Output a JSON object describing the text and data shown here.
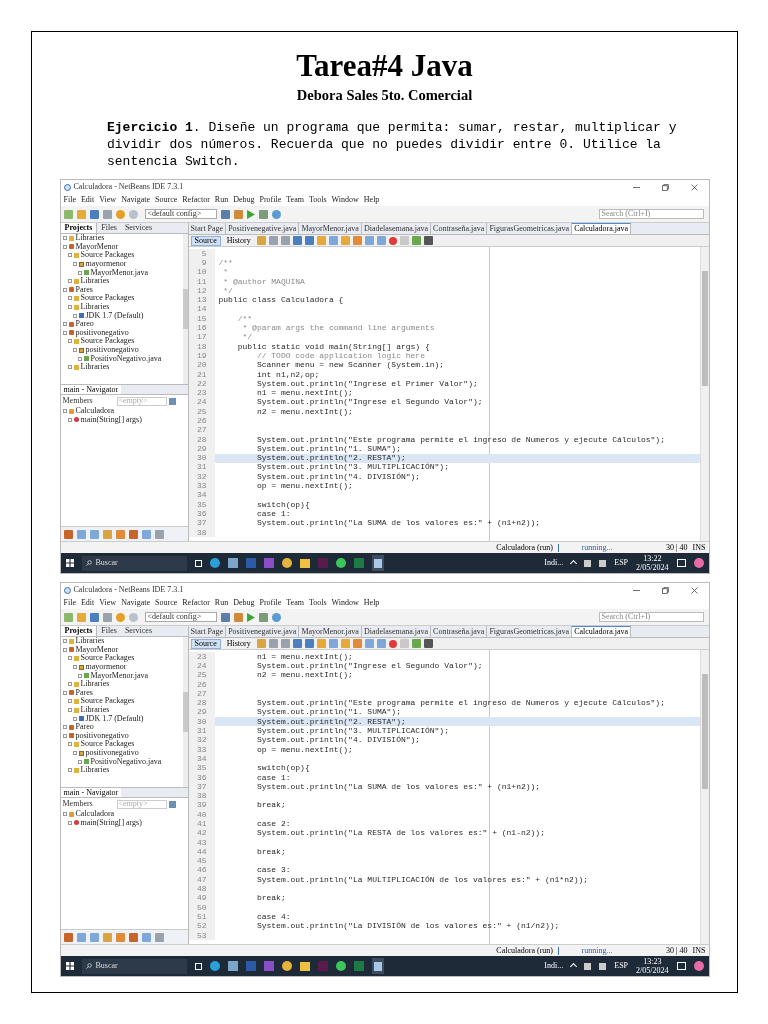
{
  "document": {
    "title": "Tarea#4 Java",
    "subtitle": "Debora Sales 5to. Comercial",
    "exercise": "**Ejercicio 1**. Diseñe un programa que permita: sumar, restar, multiplicar y dividir dos números. Recuerda que no puedes dividir entre 0. Utilice la sentencia Switch."
  },
  "screenshots": [
    {
      "window_title": "Calculadora - NetBeans IDE 7.3.1",
      "menu": [
        "File",
        "Edit",
        "View",
        "Navigate",
        "Source",
        "Refactor",
        "Run",
        "Debug",
        "Profile",
        "Team",
        "Tools",
        "Window",
        "Help"
      ],
      "config": "<default config>",
      "search_placeholder": "Search (Ctrl+I)",
      "panel_tabs": [
        {
          "label": "Projects",
          "selected": true
        },
        {
          "label": "Files",
          "selected": false
        },
        {
          "label": "Services",
          "selected": false
        }
      ],
      "project_tree": [
        {
          "label": "Libraries",
          "kind": "folder"
        },
        {
          "label": "MayorMenor",
          "kind": "project",
          "children": [
            {
              "label": "Source Packages",
              "kind": "folder",
              "children": [
                {
                  "label": "mayormenor",
                  "kind": "package",
                  "children": [
                    {
                      "label": "MayorMenor.java",
                      "kind": "file"
                    }
                  ]
                }
              ]
            },
            {
              "label": "Libraries",
              "kind": "folder"
            }
          ]
        },
        {
          "label": "Pares",
          "kind": "project",
          "children": [
            {
              "label": "Source Packages",
              "kind": "folder"
            },
            {
              "label": "Libraries",
              "kind": "folder",
              "children": [
                {
                  "label": "JDK 1.7 (Default)",
                  "kind": "jdk"
                }
              ]
            }
          ]
        },
        {
          "label": "Pareo",
          "kind": "project"
        },
        {
          "label": "positivonegativo",
          "kind": "project",
          "children": [
            {
              "label": "Source Packages",
              "kind": "folder",
              "children": [
                {
                  "label": "positivonegativo",
                  "kind": "package",
                  "children": [
                    {
                      "label": "PositivoNegativo.java",
                      "kind": "file"
                    }
                  ]
                }
              ]
            },
            {
              "label": "Libraries",
              "kind": "folder"
            }
          ]
        }
      ],
      "navigator": {
        "title": "main - Navigator",
        "members_label": "Members",
        "filter_placeholder": "<empty>",
        "tree": [
          {
            "label": "Calculadora",
            "kind": "class",
            "children": [
              {
                "label": "main(String[] args)",
                "kind": "method"
              }
            ]
          }
        ]
      },
      "editor_tabs": [
        {
          "label": "Start Page",
          "selected": false
        },
        {
          "label": "Positivenegative.java",
          "selected": false
        },
        {
          "label": "MayorMenor.java",
          "selected": false
        },
        {
          "label": "Diadelasemana.java",
          "selected": false
        },
        {
          "label": "Contraseña.java",
          "selected": false
        },
        {
          "label": "FigurasGeometricas.java",
          "selected": false
        },
        {
          "label": "Calculadora.java",
          "selected": true
        }
      ],
      "editor_modes": [
        {
          "label": "Source",
          "selected": true
        },
        {
          "label": "History",
          "selected": false
        }
      ],
      "code_lines": [
        {
          "number": "5",
          "current": false
        },
        {
          "number": "9",
          "text": "/**",
          "kind": "comment",
          "current": false
        },
        {
          "number": "10",
          "text": " *",
          "kind": "comment",
          "current": false
        },
        {
          "number": "11",
          "text": " * @author MAQUINA",
          "kind": "comment",
          "current": false
        },
        {
          "number": "12",
          "text": " */",
          "kind": "comment",
          "current": false
        },
        {
          "number": "13",
          "text": "public class Calculadora {",
          "kind": "code",
          "current": false
        },
        {
          "number": "14",
          "current": false
        },
        {
          "number": "15",
          "text": "    /**",
          "kind": "comment",
          "current": false
        },
        {
          "number": "16",
          "text": "     * @param args the command line arguments",
          "kind": "comment",
          "current": false
        },
        {
          "number": "17",
          "text": "     */",
          "kind": "comment",
          "current": false
        },
        {
          "number": "18",
          "text": "    public static void main(String[] args) {",
          "kind": "code",
          "current": false
        },
        {
          "number": "19",
          "text": "        // TODO code application logic here",
          "kind": "comment",
          "current": false
        },
        {
          "number": "20",
          "text": "        Scanner menu = new Scanner (System.in);",
          "kind": "code",
          "current": false
        },
        {
          "number": "21",
          "text": "        int n1,n2,op;",
          "kind": "code",
          "current": false
        },
        {
          "number": "22",
          "text": "        System.out.println(\"Ingrese el Primer Valor\");",
          "kind": "code",
          "current": false
        },
        {
          "number": "23",
          "text": "        n1 = menu.nextInt();",
          "kind": "code",
          "current": false
        },
        {
          "number": "24",
          "text": "        System.out.println(\"Ingrese el Segundo Valor\");",
          "kind": "code",
          "current": false
        },
        {
          "number": "25",
          "text": "        n2 = menu.nextInt();",
          "kind": "code",
          "current": false
        },
        {
          "number": "26",
          "current": false
        },
        {
          "number": "27",
          "current": false
        },
        {
          "number": "28",
          "text": "        System.out.println(\"Este programa permite el ingreso de Numeros y ejecute Cálculos\");",
          "kind": "code",
          "current": false
        },
        {
          "number": "29",
          "text": "        System.out.println(\"1. SUMA\");",
          "kind": "code",
          "current": false
        },
        {
          "number": "30",
          "text": "        System.out.println(\"2. RESTA\");",
          "kind": "code",
          "current": true
        },
        {
          "number": "31",
          "text": "        System.out.println(\"3. MULTIPLICACIÓN\");",
          "kind": "code",
          "current": false
        },
        {
          "number": "32",
          "text": "        System.out.println(\"4. DIVISIÓN\");",
          "kind": "code",
          "current": false
        },
        {
          "number": "33",
          "text": "        op = menu.nextInt();",
          "kind": "code",
          "current": false
        },
        {
          "number": "34",
          "current": false
        },
        {
          "number": "35",
          "text": "        switch(op){",
          "kind": "code",
          "current": false
        },
        {
          "number": "36",
          "text": "        case 1:",
          "kind": "code",
          "current": false
        },
        {
          "number": "37",
          "text": "        System.out.println(\"La SUMA de los valores es:\" + (n1+n2));",
          "kind": "code",
          "current": false
        },
        {
          "number": "38",
          "current": false
        }
      ],
      "status": {
        "process": "Calculadora (run)",
        "progress_label": "running...",
        "position": "30 | 40",
        "mode": "INS"
      },
      "taskbar": {
        "search": "Buscar",
        "weather": "Indi...",
        "language": "ESP",
        "time": "13:22",
        "date": "2/05/2024"
      }
    },
    {
      "window_title": "Calculadora - NetBeans IDE 7.3.1",
      "menu": [
        "File",
        "Edit",
        "View",
        "Navigate",
        "Source",
        "Refactor",
        "Run",
        "Debug",
        "Profile",
        "Team",
        "Tools",
        "Window",
        "Help"
      ],
      "config": "<default config>",
      "search_placeholder": "Search (Ctrl+I)",
      "panel_tabs": [
        {
          "label": "Projects",
          "selected": true
        },
        {
          "label": "Files",
          "selected": false
        },
        {
          "label": "Services",
          "selected": false
        }
      ],
      "project_tree": [
        {
          "label": "Libraries",
          "kind": "folder"
        },
        {
          "label": "MayorMenor",
          "kind": "project",
          "children": [
            {
              "label": "Source Packages",
              "kind": "folder",
              "children": [
                {
                  "label": "mayormenor",
                  "kind": "package",
                  "children": [
                    {
                      "label": "MayorMenor.java",
                      "kind": "file"
                    }
                  ]
                }
              ]
            },
            {
              "label": "Libraries",
              "kind": "folder"
            }
          ]
        },
        {
          "label": "Pares",
          "kind": "project",
          "children": [
            {
              "label": "Source Packages",
              "kind": "folder"
            },
            {
              "label": "Libraries",
              "kind": "folder",
              "children": [
                {
                  "label": "JDK 1.7 (Default)",
                  "kind": "jdk"
                }
              ]
            }
          ]
        },
        {
          "label": "Pareo",
          "kind": "project"
        },
        {
          "label": "positivonegativo",
          "kind": "project",
          "children": [
            {
              "label": "Source Packages",
              "kind": "folder",
              "children": [
                {
                  "label": "positivonegativo",
                  "kind": "package",
                  "children": [
                    {
                      "label": "PositivoNegativo.java",
                      "kind": "file"
                    }
                  ]
                }
              ]
            },
            {
              "label": "Libraries",
              "kind": "folder"
            }
          ]
        }
      ],
      "navigator": {
        "title": "main - Navigator",
        "members_label": "Members",
        "filter_placeholder": "<empty>",
        "tree": [
          {
            "label": "Calculadora",
            "kind": "class",
            "children": [
              {
                "label": "main(String[] args)",
                "kind": "method"
              }
            ]
          }
        ]
      },
      "editor_tabs": [
        {
          "label": "Start Page",
          "selected": false
        },
        {
          "label": "Positivenegative.java",
          "selected": false
        },
        {
          "label": "MayorMenor.java",
          "selected": false
        },
        {
          "label": "Diadelasemana.java",
          "selected": false
        },
        {
          "label": "Contraseña.java",
          "selected": false
        },
        {
          "label": "FigurasGeometricas.java",
          "selected": false
        },
        {
          "label": "Calculadora.java",
          "selected": true
        }
      ],
      "editor_modes": [
        {
          "label": "Source",
          "selected": true
        },
        {
          "label": "History",
          "selected": false
        }
      ],
      "code_lines": [
        {
          "number": "23",
          "text": "        n1 = menu.nextInt();",
          "kind": "code",
          "current": false
        },
        {
          "number": "24",
          "text": "        System.out.println(\"Ingrese el Segundo Valor\");",
          "kind": "code",
          "current": false
        },
        {
          "number": "25",
          "text": "        n2 = menu.nextInt();",
          "kind": "code",
          "current": false
        },
        {
          "number": "26",
          "current": false
        },
        {
          "number": "27",
          "current": false
        },
        {
          "number": "28",
          "text": "        System.out.println(\"Este programa permite el ingreso de Numeros y ejecute Cálculos\");",
          "kind": "code",
          "current": false
        },
        {
          "number": "29",
          "text": "        System.out.println(\"1. SUMA\");",
          "kind": "code",
          "current": false
        },
        {
          "number": "30",
          "text": "        System.out.println(\"2. RESTA\");",
          "kind": "code",
          "current": true
        },
        {
          "number": "31",
          "text": "        System.out.println(\"3. MULTIPLICACIÓN\");",
          "kind": "code",
          "current": false
        },
        {
          "number": "32",
          "text": "        System.out.println(\"4. DIVISIÓN\");",
          "kind": "code",
          "current": false
        },
        {
          "number": "33",
          "text": "        op = menu.nextInt();",
          "kind": "code",
          "current": false
        },
        {
          "number": "34",
          "current": false
        },
        {
          "number": "35",
          "text": "        switch(op){",
          "kind": "code",
          "current": false
        },
        {
          "number": "36",
          "text": "        case 1:",
          "kind": "code",
          "current": false
        },
        {
          "number": "37",
          "text": "        System.out.println(\"La SUMA de los valores es:\" + (n1+n2));",
          "kind": "code",
          "current": false
        },
        {
          "number": "38",
          "current": false
        },
        {
          "number": "39",
          "text": "        break;",
          "kind": "code",
          "current": false
        },
        {
          "number": "40",
          "current": false
        },
        {
          "number": "41",
          "text": "        case 2:",
          "kind": "code",
          "current": false
        },
        {
          "number": "42",
          "text": "        System.out.println(\"La RESTA de los valores es:\" + (n1-n2));",
          "kind": "code",
          "current": false
        },
        {
          "number": "43",
          "current": false
        },
        {
          "number": "44",
          "text": "        break;",
          "kind": "code",
          "current": false
        },
        {
          "number": "45",
          "current": false
        },
        {
          "number": "46",
          "text": "        case 3:",
          "kind": "code",
          "current": false
        },
        {
          "number": "47",
          "text": "        System.out.println(\"La MULTIPLICACIÓN de los valores es:\" + (n1*n2));",
          "kind": "code",
          "current": false
        },
        {
          "number": "48",
          "current": false
        },
        {
          "number": "49",
          "text": "        break;",
          "kind": "code",
          "current": false
        },
        {
          "number": "50",
          "current": false
        },
        {
          "number": "51",
          "text": "        case 4:",
          "kind": "code",
          "current": false
        },
        {
          "number": "52",
          "text": "        System.out.println(\"La DIVISIÓN de los valores es:\" + (n1/n2));",
          "kind": "code",
          "current": false
        },
        {
          "number": "53",
          "current": false
        }
      ],
      "status": {
        "process": "Calculadora (run)",
        "progress_label": "running...",
        "position": "30 | 40",
        "mode": "INS"
      },
      "taskbar": {
        "search": "Buscar",
        "weather": "Indi...",
        "language": "ESP",
        "time": "13:23",
        "date": "2/05/2024"
      }
    }
  ]
}
